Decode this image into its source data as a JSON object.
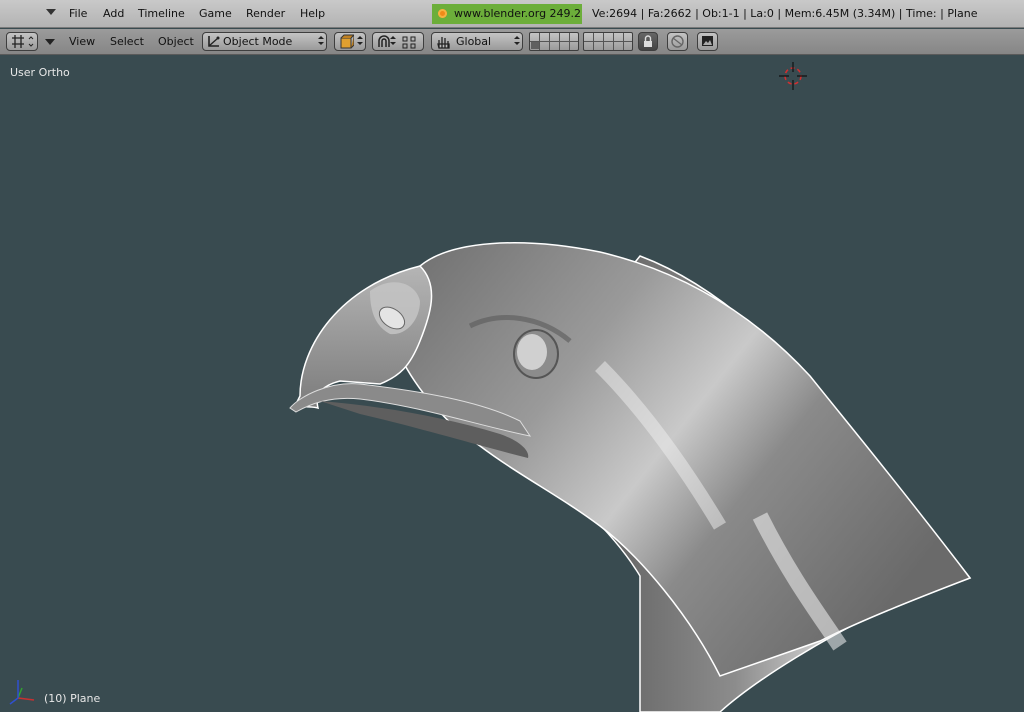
{
  "info_header": {
    "menus": [
      "File",
      "Add",
      "Timeline",
      "Game",
      "Render",
      "Help"
    ],
    "site_badge": "www.blender.org 249.2",
    "stats": "Ve:2694 | Fa:2662 | Ob:1-1 | La:0  | Mem:6.45M (3.34M)  | Time: | Plane"
  },
  "view_header": {
    "menus": [
      "View",
      "Select",
      "Object"
    ],
    "mode": "Object Mode",
    "orientation": "Global"
  },
  "viewport": {
    "view_label": "User Ortho",
    "object_label": "(10) Plane",
    "background_color": "#394b50",
    "axes": {
      "x_color": "#c83030",
      "y_color": "#30a030",
      "z_color": "#3050d0"
    }
  }
}
